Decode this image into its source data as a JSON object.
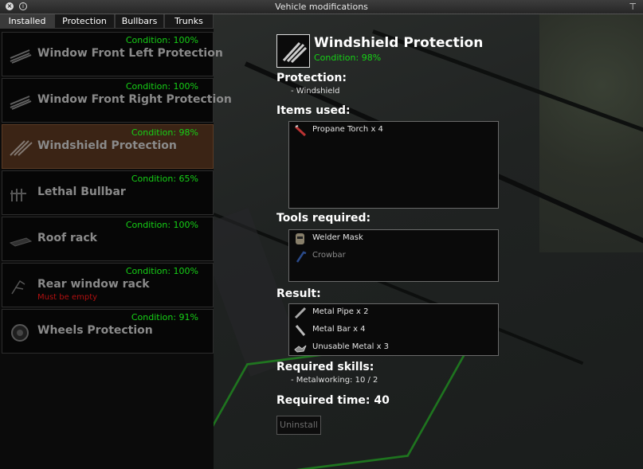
{
  "window": {
    "title": "Vehicle modifications"
  },
  "tabs": [
    {
      "label": "Installed"
    },
    {
      "label": "Protection"
    },
    {
      "label": "Bullbars"
    },
    {
      "label": "Trunks"
    }
  ],
  "parts": [
    {
      "name": "Window Front Left Protection",
      "condition": "Condition: 100%",
      "icon": "window-protection-icon"
    },
    {
      "name": "Window Front Right Protection",
      "condition": "Condition: 100%",
      "icon": "window-protection-icon"
    },
    {
      "name": "Windshield Protection",
      "condition": "Condition: 98%",
      "icon": "windshield-protection-icon"
    },
    {
      "name": "Lethal Bullbar",
      "condition": "Condition: 65%",
      "icon": "bullbar-icon"
    },
    {
      "name": "Roof rack",
      "condition": "Condition: 100%",
      "icon": "roof-rack-icon"
    },
    {
      "name": "Rear window rack",
      "condition": "Condition: 100%",
      "icon": "rear-rack-icon",
      "warning": "Must be empty"
    },
    {
      "name": "Wheels Protection",
      "condition": "Condition: 91%",
      "icon": "wheel-protection-icon"
    }
  ],
  "selected": {
    "title": "Windshield Protection",
    "condition": "Condition: 98%",
    "protection_label": "Protection:",
    "protection_value": "- Windshield",
    "items_label": "Items used:",
    "items": [
      {
        "name": "Propane Torch x 4",
        "icon": "propane-torch-icon"
      }
    ],
    "tools_label": "Tools required:",
    "tools": [
      {
        "name": "Welder Mask",
        "icon": "welder-mask-icon"
      },
      {
        "name": "Crowbar",
        "icon": "crowbar-icon"
      }
    ],
    "result_label": "Result:",
    "results": [
      {
        "name": "Metal Pipe x 2",
        "icon": "metal-pipe-icon"
      },
      {
        "name": "Metal Bar x 4",
        "icon": "metal-bar-icon"
      },
      {
        "name": "Unusable Metal x 3",
        "icon": "unusable-metal-icon"
      }
    ],
    "skills_label": "Required skills:",
    "skills_value": "- Metalworking: 10 / 2",
    "time_label": "Required time: 40",
    "uninstall_label": "Uninstall"
  }
}
